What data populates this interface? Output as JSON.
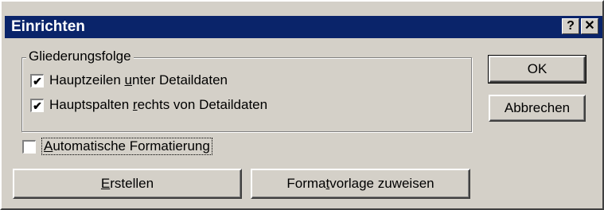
{
  "window": {
    "title": "Einrichten",
    "help_label": "?",
    "close_label": "✕"
  },
  "group": {
    "label": "Gliederungsfolge",
    "options": [
      {
        "pre": "Hauptzeilen ",
        "mnemonic": "u",
        "post": "nter Detaildaten",
        "checked": true
      },
      {
        "pre": "Hauptspalten ",
        "mnemonic": "r",
        "post": "echts von Detaildaten",
        "checked": true
      }
    ]
  },
  "auto_format": {
    "mnemonic": "A",
    "post": "utomatische Formatierung",
    "checked": false
  },
  "buttons": {
    "ok": "OK",
    "cancel": "Abbrechen",
    "create": {
      "mnemonic": "E",
      "post": "rstellen"
    },
    "assign_style": {
      "pre": "Forma",
      "mnemonic": "t",
      "post": "vorlage zuweisen"
    }
  },
  "icons": {
    "checked_glyph": "✔"
  }
}
